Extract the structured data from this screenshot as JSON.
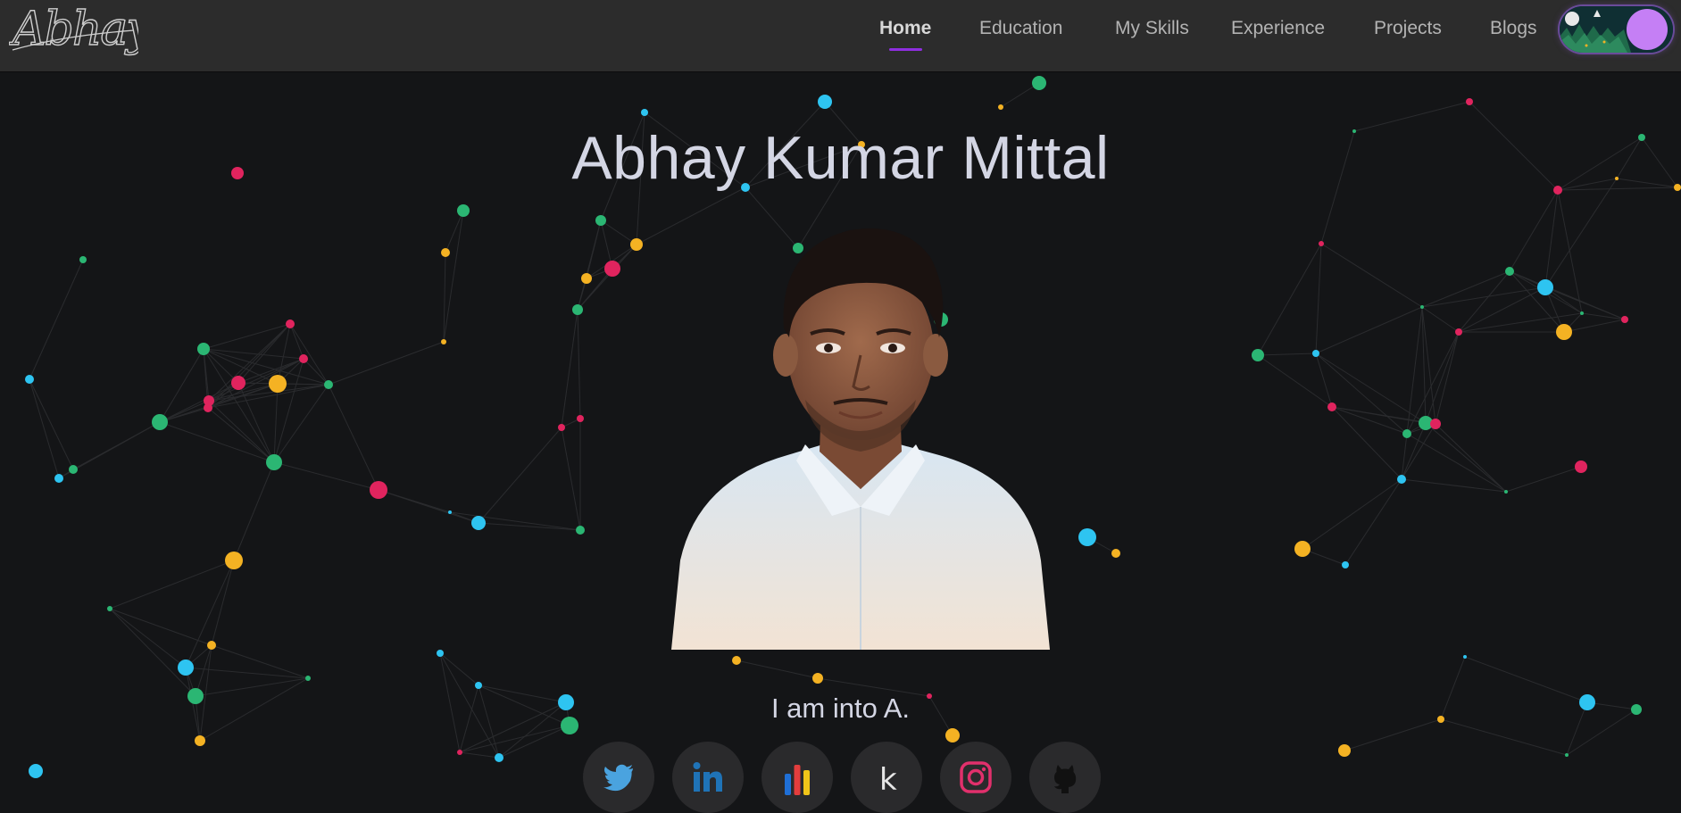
{
  "header": {
    "logo_text": "Abhay",
    "nav": [
      {
        "label": "Home",
        "active": true
      },
      {
        "label": "Education",
        "active": false
      },
      {
        "label": "My Skills",
        "active": false
      },
      {
        "label": "Experience",
        "active": false
      },
      {
        "label": "Projects",
        "active": false
      },
      {
        "label": "Blogs",
        "active": false
      }
    ],
    "theme_toggle": {
      "state": "dark",
      "knob_color": "#c57ff5"
    }
  },
  "hero": {
    "name": "Abhay Kumar Mittal",
    "tagline": "I am into A",
    "tagline_cursor": "."
  },
  "socials": [
    {
      "name": "twitter",
      "icon": "twitter-icon",
      "color": "#4aa3df"
    },
    {
      "name": "linkedin",
      "icon": "linkedin-icon",
      "color": "#1f73b7"
    },
    {
      "name": "bar-chart",
      "icon": "bar-chart-icon",
      "colors": [
        "#1f6fd6",
        "#e33d3d",
        "#f0c419"
      ]
    },
    {
      "name": "kaggle",
      "icon": "kaggle-icon",
      "label": "k",
      "color": "#e6e6e6"
    },
    {
      "name": "instagram",
      "icon": "instagram-icon",
      "color": "#e1306c"
    },
    {
      "name": "github",
      "icon": "github-icon",
      "color": "#111111"
    }
  ],
  "background": {
    "color": "#141517",
    "particle_colors": [
      "#2ec4f1",
      "#e0245e",
      "#f4b223",
      "#2bb673"
    ]
  }
}
